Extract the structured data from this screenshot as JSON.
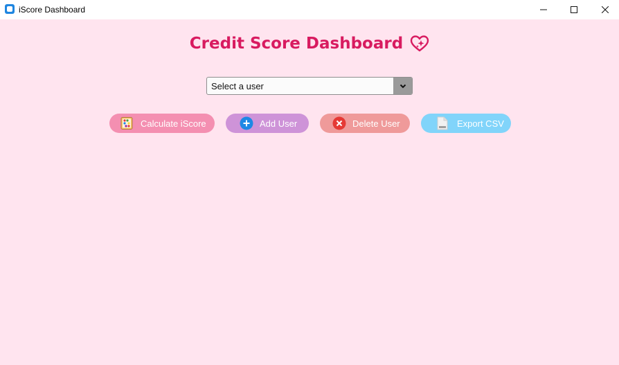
{
  "window": {
    "title": "iScore Dashboard",
    "icon": "app-icon",
    "controls": {
      "minimize_icon": "minimize-icon",
      "maximize_icon": "maximize-icon",
      "close_icon": "close-icon"
    }
  },
  "header": {
    "title": "Credit Score Dashboard",
    "icon": "heart-sparkle-icon"
  },
  "user_select": {
    "selected": "Select a user",
    "arrow_icon": "chevron-down-icon"
  },
  "actions": [
    {
      "label": "Calculate iScore",
      "icon": "abacus-icon",
      "color": "#f48fb1"
    },
    {
      "label": "Add User",
      "icon": "plus-circle-icon",
      "color": "#ce93d8"
    },
    {
      "label": "Delete User",
      "icon": "x-circle-icon",
      "color": "#ef9a9a"
    },
    {
      "label": "Export CSV",
      "icon": "document-icon",
      "color": "#81d4fa"
    }
  ],
  "colors": {
    "background": "#ffe4ef",
    "title": "#d81b60"
  }
}
